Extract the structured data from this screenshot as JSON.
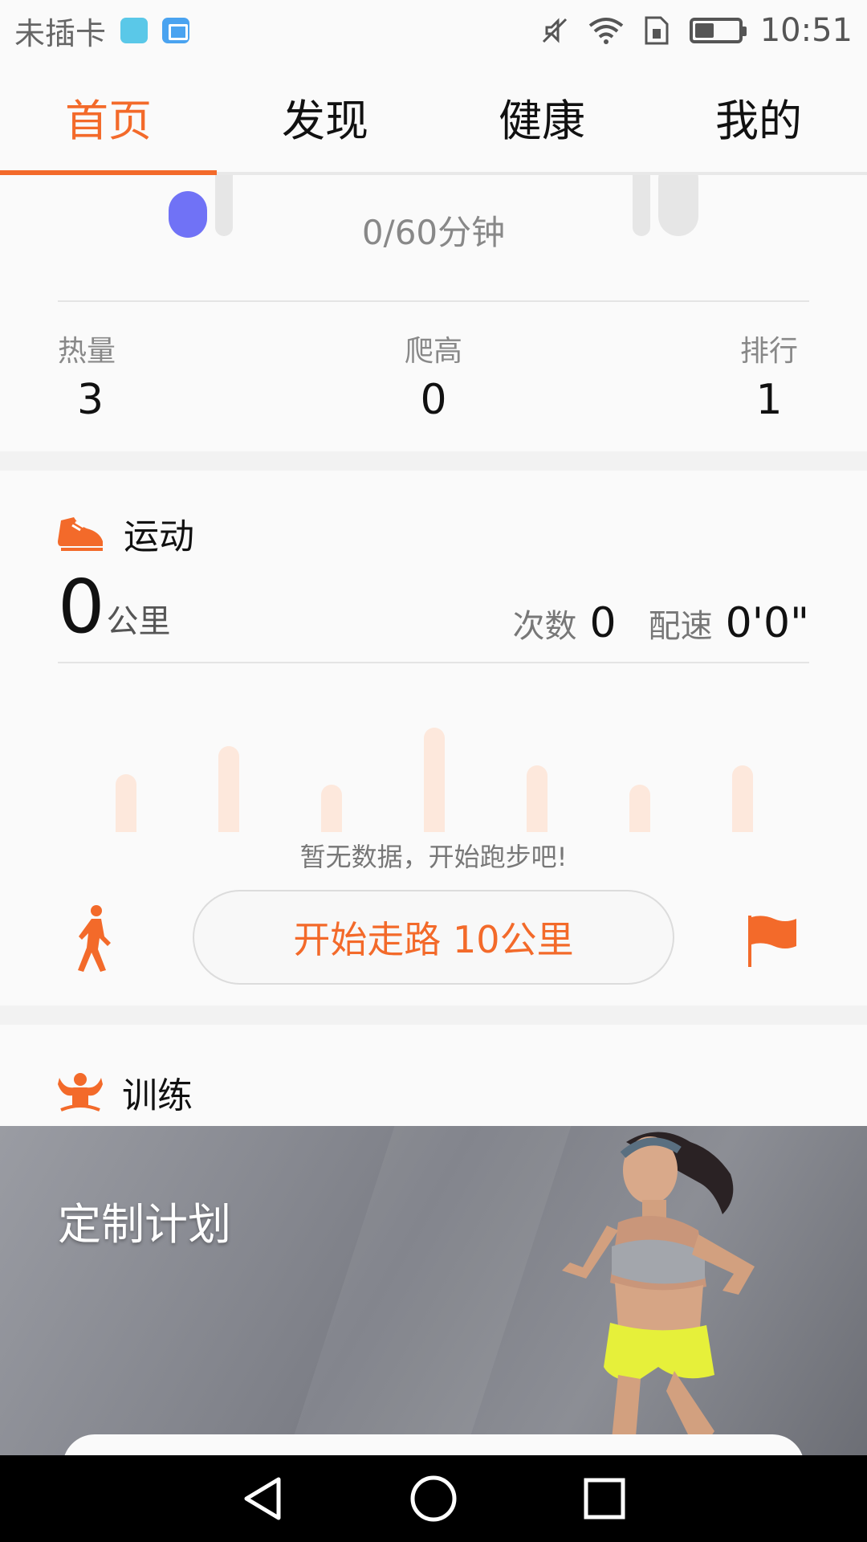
{
  "status_bar": {
    "carrier": "未插卡",
    "time": "10:51",
    "battery_level": 0.45
  },
  "tabs": [
    {
      "label": "首页",
      "active": true
    },
    {
      "label": "发现",
      "active": false
    },
    {
      "label": "健康",
      "active": false
    },
    {
      "label": "我的",
      "active": false
    }
  ],
  "summary": {
    "active_minutes": "0/60分钟",
    "stats": [
      {
        "label": "热量",
        "value": "3"
      },
      {
        "label": "爬高",
        "value": "0"
      },
      {
        "label": "排行",
        "value": "1"
      }
    ]
  },
  "sport": {
    "title": "运动",
    "distance_value": "0",
    "distance_unit": "公里",
    "count_label": "次数",
    "count_value": "0",
    "pace_label": "配速",
    "pace_value": "0'0\"",
    "no_data_text": "暂无数据，开始跑步吧!",
    "start_button_label": "开始走路 10公里",
    "placeholder_bar_levels": [
      0.55,
      0.82,
      0.45,
      1.0,
      0.64,
      0.45,
      0.64
    ]
  },
  "training": {
    "title": "训练",
    "banner_title": "定制计划"
  },
  "colors": {
    "accent": "#f36a2a",
    "ring_dot": "#7072f6",
    "bar_placeholder": "#fde8dc"
  },
  "icons": [
    "mute-icon",
    "wifi-icon",
    "sim-icon",
    "battery-icon",
    "shoe-icon",
    "walker-icon",
    "flag-icon",
    "muscle-icon",
    "back-icon",
    "home-icon",
    "recents-icon"
  ]
}
